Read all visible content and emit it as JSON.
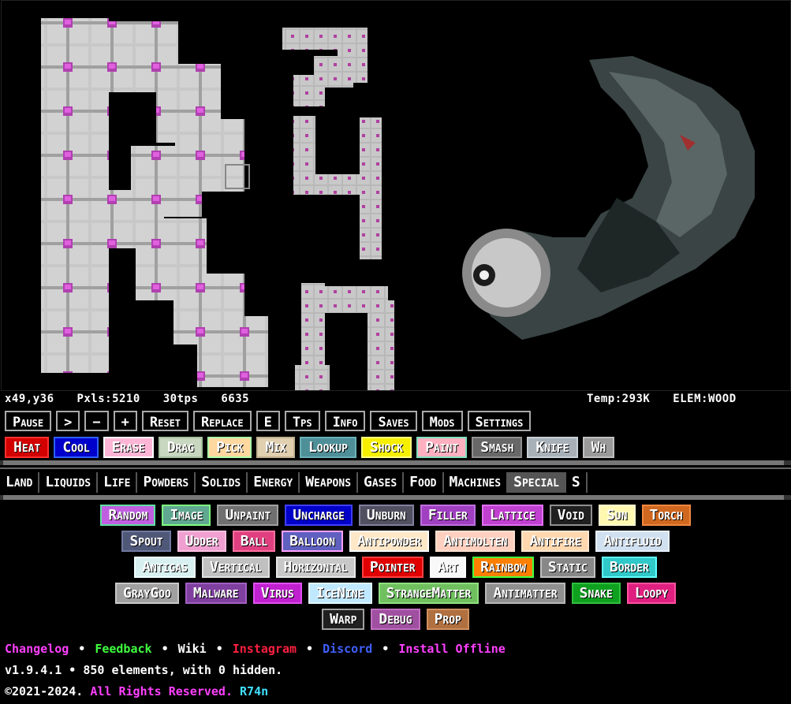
{
  "stats_left": {
    "coords": "x49,y36",
    "pixels": "Pxls:5210",
    "tps": "30tps",
    "count": "6635"
  },
  "stats_right": {
    "temp": "Temp:293K",
    "elem": "ELEM:WOOD"
  },
  "controls": [
    "Pause",
    ">",
    "−",
    "+",
    "Reset",
    "Replace",
    "E",
    "Tps",
    "Info",
    "Saves",
    "Mods",
    "Settings"
  ],
  "tools": [
    {
      "label": "Heat",
      "bg": "#d20000",
      "border": "#ff3030"
    },
    {
      "label": "Cool",
      "bg": "#0000cc",
      "border": "#3060ff"
    },
    {
      "label": "Erase",
      "bg": "#ffb6d6",
      "border": "#ffffff"
    },
    {
      "label": "Drag",
      "bg": "#c8d8c0",
      "border": "#a8c0a0"
    },
    {
      "label": "Pick",
      "bg": "#ffd8a0",
      "border": "#aaffaa"
    },
    {
      "label": "Mix",
      "bg": "#e0d0b0",
      "border": "#c0b090"
    },
    {
      "label": "Lookup",
      "bg": "#4f8f98",
      "border": "#6ab0b8"
    },
    {
      "label": "Shock",
      "bg": "#f6f000",
      "border": "#ffff80"
    },
    {
      "label": "Paint",
      "bg": "#ffb0c0",
      "border": "#80e0c0"
    },
    {
      "label": "Smash",
      "bg": "#686868",
      "border": "#909090"
    },
    {
      "label": "Knife",
      "bg": "#a8b0b8",
      "border": "#c8d0d8"
    },
    {
      "label": "Wh",
      "bg": "#9a9a9a",
      "border": "#c0c0c0"
    }
  ],
  "categories": [
    "Land",
    "Liquids",
    "Life",
    "Powders",
    "Solids",
    "Energy",
    "Weapons",
    "Gases",
    "Food",
    "Machines",
    "Special",
    "S"
  ],
  "active_category": "Special",
  "elements": [
    [
      {
        "label": "Random",
        "bg": "#c060e0",
        "border": "#60e0a0"
      },
      {
        "label": "Image",
        "bg": "#60a890",
        "border": "#80ff80"
      },
      {
        "label": "Unpaint",
        "bg": "#707070",
        "border": "#a0a0a0"
      },
      {
        "label": "Uncharge",
        "bg": "#0000c8",
        "border": "#4040ff"
      },
      {
        "label": "Unburn",
        "bg": "#505060",
        "border": "#8080a0"
      },
      {
        "label": "Filler",
        "bg": "#a040c0",
        "border": "#c070e0"
      },
      {
        "label": "Lattice",
        "bg": "#c040d0",
        "border": "#e070f0"
      },
      {
        "label": "Void",
        "bg": "#202020",
        "border": "#909090"
      },
      {
        "label": "Sun",
        "bg": "#fff8b0",
        "border": "#ffffd0"
      },
      {
        "label": "Torch",
        "bg": "#d06820",
        "border": "#f08840"
      }
    ],
    [
      {
        "label": "Spout",
        "bg": "#505878",
        "border": "#7078a0"
      },
      {
        "label": "Udder",
        "bg": "#f0a0d0",
        "border": "#ffc0e0"
      },
      {
        "label": "Ball",
        "bg": "#e04080",
        "border": "#ff70a0"
      },
      {
        "label": "Balloon",
        "bg": "#6060c0",
        "border": "#ffa0ff"
      },
      {
        "label": "Antipowder",
        "bg": "#ffe8c8",
        "border": "#ffffff"
      },
      {
        "label": "Antimolten",
        "bg": "#ffd0c0",
        "border": "#ffe0d0"
      },
      {
        "label": "Antifire",
        "bg": "#ffd8b0",
        "border": "#ffe8d0"
      },
      {
        "label": "Antifluid",
        "bg": "#d0e0f0",
        "border": "#e8f0ff"
      }
    ],
    [
      {
        "label": "Antigas",
        "bg": "#d8f0f0",
        "border": "#f0ffff"
      },
      {
        "label": "Vertical",
        "bg": "#c0c0c0",
        "border": "#e0e0e0"
      },
      {
        "label": "Horizontal",
        "bg": "#c8c8c8",
        "border": "#e8e8e8"
      },
      {
        "label": "Pointer",
        "bg": "#e00000",
        "border": "#ff4040"
      },
      {
        "label": "Art",
        "bg": "#f8f8f8",
        "border": "#ffffff"
      },
      {
        "label": "Rainbow",
        "bg": "#ff8000",
        "border": "#40ff40"
      },
      {
        "label": "Static",
        "bg": "#888888",
        "border": "#c0c0c0"
      },
      {
        "label": "Border",
        "bg": "#30c8c8",
        "border": "#60ffff"
      }
    ],
    [
      {
        "label": "GrayGoo",
        "bg": "#a0a0a0",
        "border": "#c8c8c8"
      },
      {
        "label": "Malware",
        "bg": "#8040a0",
        "border": "#a060c0"
      },
      {
        "label": "Virus",
        "bg": "#c020d0",
        "border": "#e050f0"
      },
      {
        "label": "IceNine",
        "bg": "#c0e8ff",
        "border": "#e0f8ff"
      },
      {
        "label": "StrangeMatter",
        "bg": "#70c060",
        "border": "#90e080"
      },
      {
        "label": "Antimatter",
        "bg": "#909090",
        "border": "#b8b8b8"
      },
      {
        "label": "Snake",
        "bg": "#10a020",
        "border": "#30c040"
      },
      {
        "label": "Loopy",
        "bg": "#e02080",
        "border": "#ff50a0"
      }
    ],
    [
      {
        "label": "Warp",
        "bg": "#202020",
        "border": "#a0a0a0"
      },
      {
        "label": "Debug",
        "bg": "#a050a0",
        "border": "#c070c0"
      },
      {
        "label": "Prop",
        "bg": "#b07040",
        "border": "#d09060"
      }
    ]
  ],
  "links": [
    {
      "label": "Changelog",
      "color": "#ff40ff"
    },
    {
      "label": "Feedback",
      "color": "#40ff40"
    },
    {
      "label": "Wiki",
      "color": "#ffffff"
    },
    {
      "label": "Instagram",
      "color": "#ff2040"
    },
    {
      "label": "Discord",
      "color": "#4060ff"
    },
    {
      "label": "Install Offline",
      "color": "#ff40ff"
    }
  ],
  "version_line": "v1.9.4.1 • 850 elements, with 0 hidden.",
  "copyright": {
    "year": "©2021-2024.",
    "rights": "All Rights Reserved.",
    "author": "R74n"
  },
  "canvas_text": [
    "R",
    "7",
    "4",
    "n"
  ]
}
